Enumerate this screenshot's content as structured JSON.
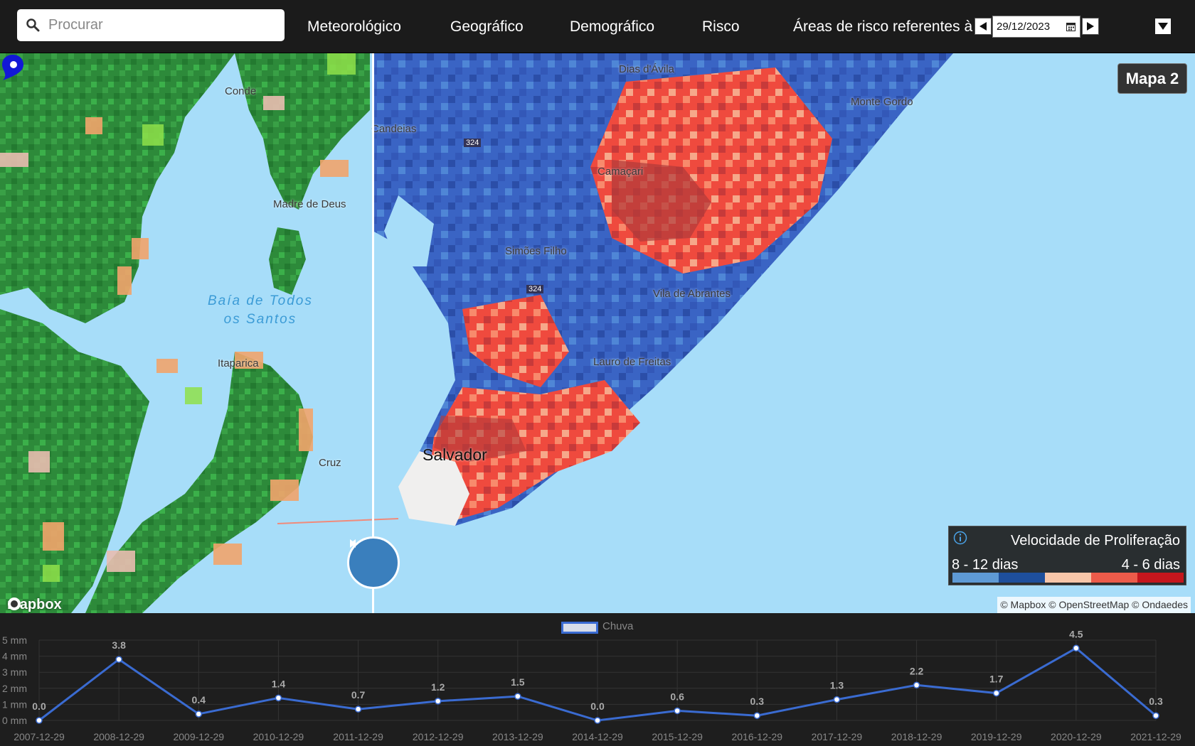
{
  "search": {
    "placeholder": "Procurar"
  },
  "nav": {
    "items": [
      "Meteorológico",
      "Geográfico",
      "Demográfico",
      "Risco"
    ],
    "risk_label": "Áreas de risco referentes à",
    "date": "29/12/2023"
  },
  "map": {
    "title": "Mapa 2",
    "places": {
      "conde": "Conde",
      "madre": "Madre de Deus",
      "baia": [
        "Baía de Todos",
        "os Santos"
      ],
      "itaparica": "Itaparica",
      "cruz": "Cruz",
      "dias": "Dias d'Ávila",
      "candeias": "Candeias",
      "camacari": "Camaçari",
      "monte": "Monte Gordo",
      "simoes": "Simões Filho",
      "vila": "Vila de Abrantes",
      "lauro": "Lauro de Freitas",
      "salvador": "Salvador",
      "road1": "324",
      "road2": "324"
    },
    "legend": {
      "title": "Velocidade de Proliferação",
      "low": "8 - 12 dias",
      "high": "4 - 6 dias",
      "colors": [
        "#5e9ad5",
        "#1e4f9c",
        "#f7c6a9",
        "#ec5b4a",
        "#c5161d"
      ]
    },
    "attribution": "© Mapbox © OpenStreetMap © Ondaedes",
    "logo": "mapbox"
  },
  "chart_data": {
    "type": "line",
    "title": "",
    "legend": "Chuva",
    "x": [
      "2007-12-29",
      "2008-12-29",
      "2009-12-29",
      "2010-12-29",
      "2011-12-29",
      "2012-12-29",
      "2013-12-29",
      "2014-12-29",
      "2015-12-29",
      "2016-12-29",
      "2017-12-29",
      "2018-12-29",
      "2019-12-29",
      "2020-12-29",
      "2021-12-29"
    ],
    "series": [
      {
        "name": "Chuva",
        "values": [
          0.0,
          3.8,
          0.4,
          1.4,
          0.7,
          1.2,
          1.5,
          0.0,
          0.6,
          0.3,
          1.3,
          2.2,
          1.7,
          4.5,
          0.3
        ]
      }
    ],
    "yticks": [
      "0 mm",
      "1 mm",
      "2 mm",
      "3 mm",
      "4 mm",
      "5 mm"
    ],
    "ylim": [
      0,
      5
    ],
    "grid": true,
    "line_color": "#3a6bd1"
  }
}
